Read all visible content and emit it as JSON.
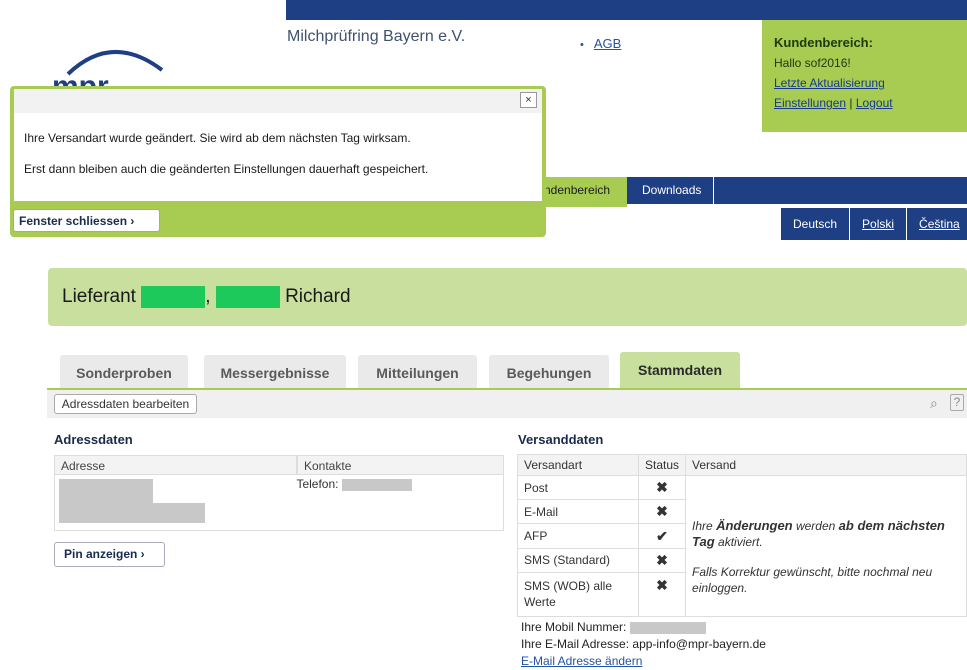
{
  "header": {
    "org_name": "Milchprüfring Bayern e.V.",
    "agb_link": "AGB",
    "bullet": "•",
    "logo_text": "mpr"
  },
  "kundenbereich": {
    "title": "Kundenbereich:",
    "greeting": "Hallo sof2016!",
    "last_update": "Letzte Aktualisierung",
    "settings": "Einstellungen",
    "separator": "|",
    "logout": "Logout"
  },
  "nav": {
    "active_tab": "ndenbereich",
    "downloads": "Downloads",
    "languages": [
      "Deutsch",
      "Polski",
      "Čeština"
    ]
  },
  "modal": {
    "close_symbol": "×",
    "line1": "Ihre Versandart wurde geändert. Sie wird ab dem nächsten Tag wirksam.",
    "line2": "Erst dann bleiben auch die geänderten Einstellungen dauerhaft gespeichert.",
    "close_button": "Fenster schliessen ›"
  },
  "supplier": {
    "prefix": "Lieferant",
    "comma": ",",
    "name": "Richard"
  },
  "tabs": [
    "Sonderproben",
    "Messergebnisse",
    "Mitteilungen",
    "Begehungen",
    "Stammdaten"
  ],
  "toolbar": {
    "edit_button": "Adressdaten bearbeiten",
    "search_icon": "⌕",
    "help_icon": "?"
  },
  "address": {
    "title": "Adressdaten",
    "col_address": "Adresse",
    "col_contacts": "Kontakte",
    "phone_label": "Telefon:",
    "pin_button": "Pin anzeigen ›"
  },
  "shipping": {
    "title": "Versanddaten",
    "columns": [
      "Versandart",
      "Status",
      "Versand"
    ],
    "rows": [
      {
        "type": "Post",
        "status": "✖"
      },
      {
        "type": "E-Mail",
        "status": "✖"
      },
      {
        "type": "AFP",
        "status": "✔"
      },
      {
        "type": "SMS (Standard)",
        "status": "✖"
      },
      {
        "type": "SMS (WOB) alle Werte",
        "status": "✖"
      }
    ],
    "note_a": "Ihre",
    "note_b": "Änderungen",
    "note_c": "werden",
    "note_d": "ab dem nächsten Tag",
    "note_e": "aktiviert.",
    "note2": "Falls Korrektur gewünscht, bitte nochmal neu einloggen.",
    "mobile_label": "Ihre Mobil Nummer:",
    "email_label": "Ihre E-Mail Adresse:",
    "email_value": "app-info@mpr-bayern.de",
    "email_change": "E-Mail Adresse ändern"
  }
}
